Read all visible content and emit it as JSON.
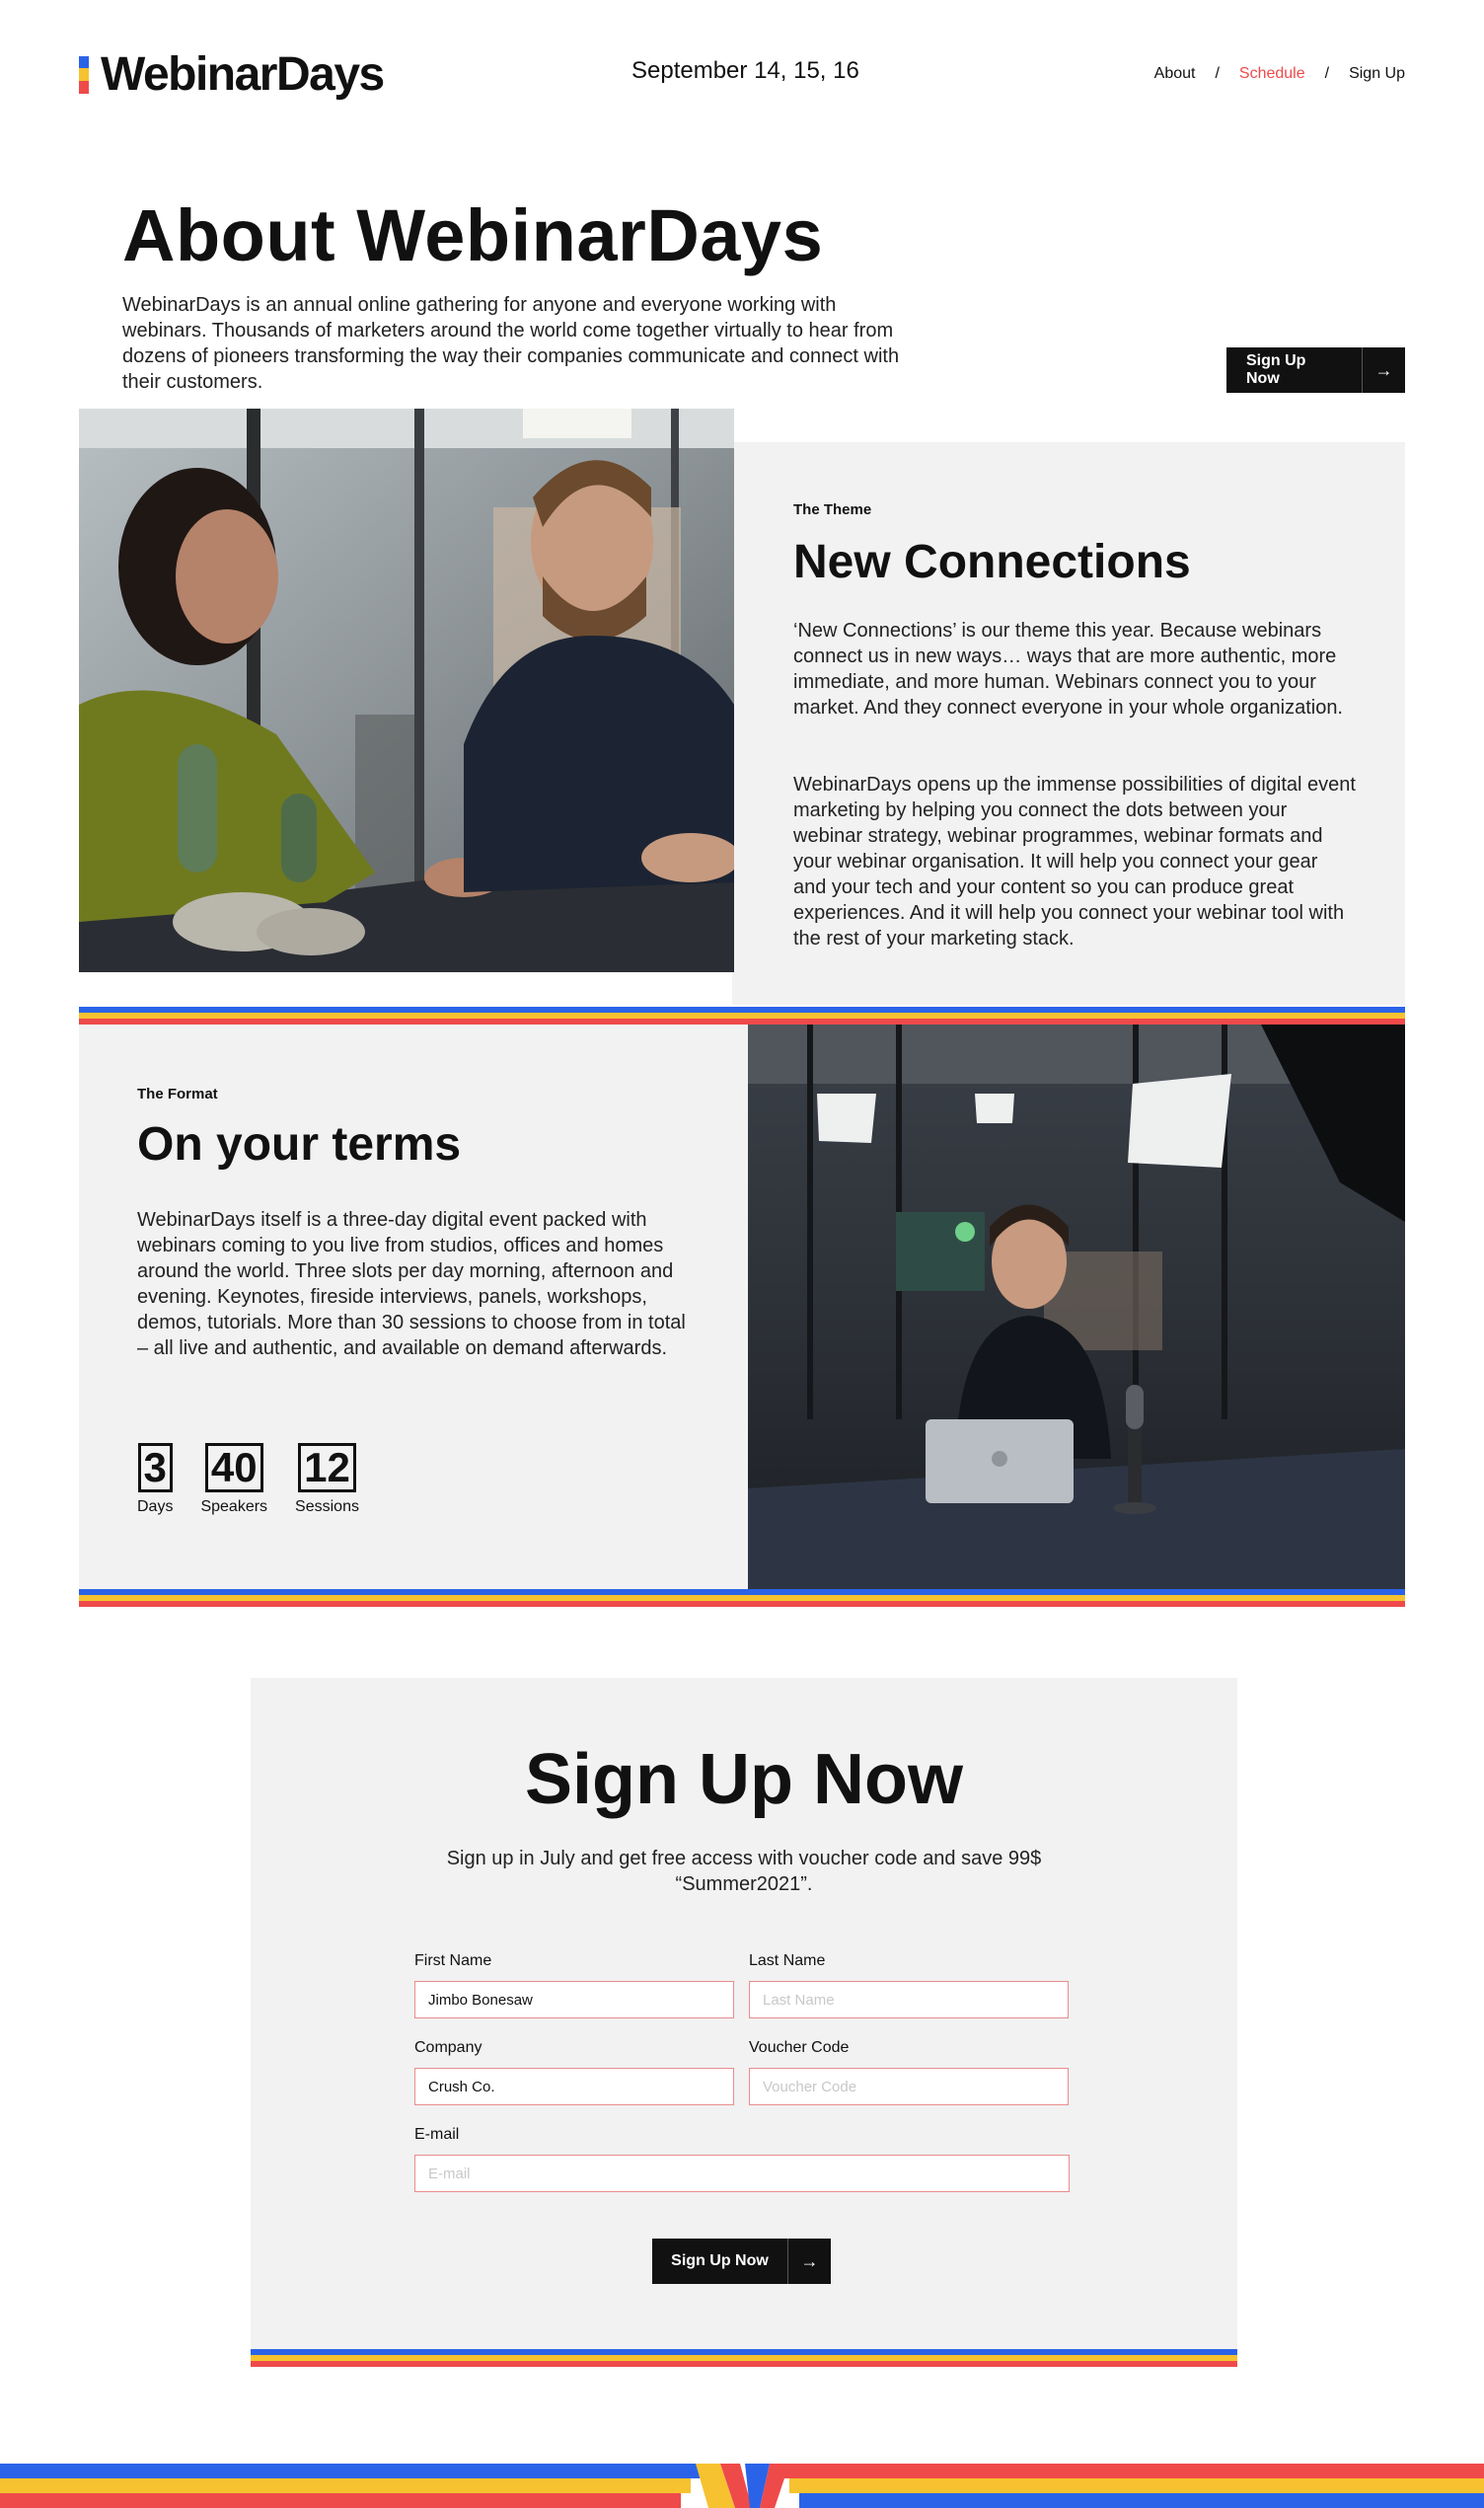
{
  "brand": {
    "name": "WebinarDays",
    "colors": {
      "blue": "#2b63e8",
      "yellow": "#f6c230",
      "red": "#ef4a4a"
    }
  },
  "header": {
    "date": "September 14, 15, 16",
    "nav": [
      {
        "label": "About"
      },
      {
        "label": "Schedule",
        "active": true
      },
      {
        "label": "Sign Up"
      }
    ],
    "separator": "/"
  },
  "about": {
    "title": "About WebinarDays",
    "text": "WebinarDays is an annual online gathering for anyone and everyone working with webinars.  Thousands of marketers around the world come together virtually to hear from dozens of pioneers transforming the way their companies communicate and connect with their customers.",
    "button_label": "Sign Up Now",
    "button_icon": "arrow-right-icon"
  },
  "theme": {
    "eyebrow": "The Theme",
    "title": "New Connections",
    "paragraph1": "‘New Connections’ is our theme this year. Because webinars connect us in new ways… ways that are more authentic, more immediate, and more human. Webinars connect you to your market. And they connect everyone in your whole organization.",
    "paragraph2": "WebinarDays opens up the immense possibilities of digital event marketing by helping you connect the dots between your webinar strategy, webinar programmes, webinar formats and your webinar organisation. It will help you connect your gear and your tech and your content so you can produce great experiences. And it will help you connect your webinar tool with the rest of your marketing stack."
  },
  "format": {
    "eyebrow": "The Format",
    "title": "On your terms",
    "text": "WebinarDays itself is a three-day digital event packed with webinars coming to you live from studios, offices and homes around the world. Three slots per day morning, afternoon and evening. Keynotes, fireside interviews, panels, workshops, demos, tutorials. More than 30 sessions to choose from in total – all live and authentic, and available on demand afterwards.",
    "stats": [
      {
        "value": "3",
        "label": "Days"
      },
      {
        "value": "40",
        "label": "Speakers"
      },
      {
        "value": "12",
        "label": "Sessions"
      }
    ]
  },
  "signup": {
    "title": "Sign Up Now",
    "subtitle": "Sign up in July and get free access with voucher code and save 99$ “Summer2021”.",
    "fields": {
      "first_name": {
        "label": "First Name",
        "value": "Jimbo Bonesaw",
        "placeholder": "First Name"
      },
      "last_name": {
        "label": "Last Name",
        "value": "",
        "placeholder": "Last Name"
      },
      "company": {
        "label": "Company",
        "value": "Crush Co.",
        "placeholder": "Company"
      },
      "voucher": {
        "label": "Voucher Code",
        "value": "",
        "placeholder": "Voucher Code"
      },
      "email": {
        "label": "E-mail",
        "value": "",
        "placeholder": "E-mail"
      }
    },
    "button_label": "Sign Up Now",
    "button_icon": "arrow-right-icon"
  }
}
